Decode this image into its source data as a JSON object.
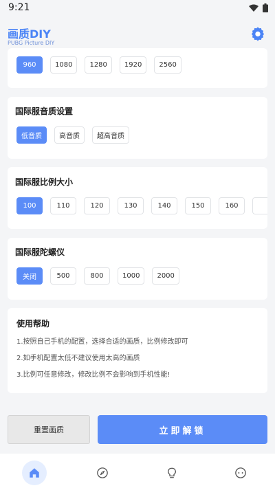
{
  "status": {
    "time": "9:21"
  },
  "app": {
    "title": "画质DIY",
    "subtitle": "PUBG Picture DIY"
  },
  "resolution": {
    "options": [
      "960",
      "1080",
      "1280",
      "1920",
      "2560"
    ],
    "selected": "960"
  },
  "sound": {
    "title": "国际服音质设置",
    "options": [
      "低音质",
      "高音质",
      "超高音质"
    ],
    "selected": "低音质"
  },
  "ratio": {
    "title": "国际服比例大小",
    "options": [
      "100",
      "110",
      "120",
      "130",
      "140",
      "150",
      "160"
    ],
    "selected": "100"
  },
  "gyro": {
    "title": "国际服陀螺仪",
    "options": [
      "关闭",
      "500",
      "800",
      "1000",
      "2000"
    ],
    "selected": "关闭"
  },
  "help": {
    "title": "使用帮助",
    "lines": [
      "1.按照自己手机的配置，选择合适的画质，比例修改即可",
      "2.如手机配置太低不建议使用太高的画质",
      "3.比例可任意修改，修改比例不会影响到手机性能!"
    ]
  },
  "actions": {
    "reset": "重置画质",
    "unlock": "立即解锁"
  },
  "colors": {
    "accent": "#5b8cf7",
    "title": "#4b84f6"
  },
  "nav": {
    "items": [
      "home-icon",
      "compass-icon",
      "bulb-icon",
      "face-icon"
    ],
    "active": "home-icon"
  }
}
